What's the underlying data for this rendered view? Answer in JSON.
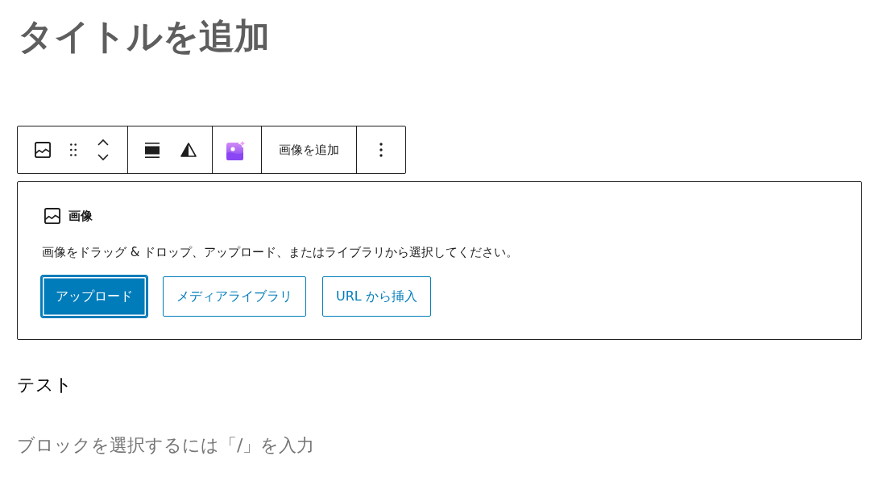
{
  "post_title": {
    "placeholder": "タイトルを追加"
  },
  "block_toolbar": {
    "add_image_button": "画像を追加"
  },
  "image_block": {
    "label": "画像",
    "instructions": "画像をドラッグ & ドロップ、アップロード、またはライブラリから選択してください。",
    "buttons": [
      {
        "label": "アップロード",
        "kind": "primary",
        "focused": true
      },
      {
        "label": "メディアライブラリ",
        "kind": "secondary",
        "focused": false
      },
      {
        "label": "URL から挿入",
        "kind": "secondary",
        "focused": false
      }
    ]
  },
  "paragraphs": [
    {
      "text": "テスト"
    }
  ],
  "block_appender": {
    "placeholder": "ブロックを選択するには「/」を入力"
  }
}
